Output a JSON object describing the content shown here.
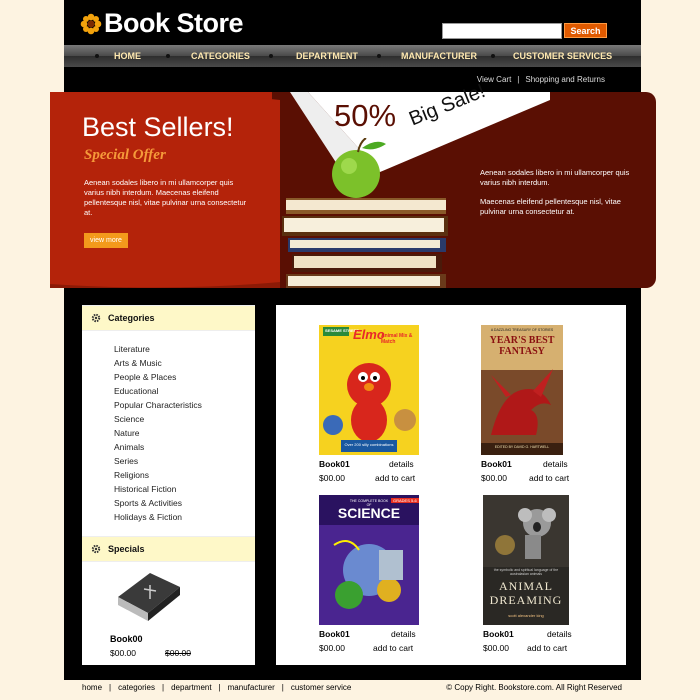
{
  "header": {
    "title": "Book Store",
    "search_placeholder": "",
    "search_button": "Search"
  },
  "nav": {
    "items": [
      "HOME",
      "CATEGORIES",
      "DEPARTMENT",
      "MANUFACTURER",
      "CUSTOMER SERVICES"
    ]
  },
  "sublinks": [
    "View Cart",
    "Shopping and Returns"
  ],
  "banner": {
    "title": "Best Sellers!",
    "subtitle": "Special Offer",
    "text": "Aenean sodales libero in mi ullamcorper quis varius nibh interdum. Maecenas eleifend pellentesque nisl, vitae pulvinar urna consectetur at.",
    "button": "view more",
    "sale_percent": "50%",
    "sale_text": "Big Sale!",
    "right_text_1": "Aenean sodales libero in mi ullamcorper quis varius nibh interdum.",
    "right_text_2": "Maecenas eleifend pellentesque nisl, vitae pulvinar urna consectetur at."
  },
  "sidebar": {
    "categories_title": "Categories",
    "categories": [
      "Literature",
      "Arts & Music",
      "People & Places",
      "Educational",
      "Popular Characteristics",
      "Science",
      "Nature",
      "Animals",
      "Series",
      "Religions",
      "Historical Fiction",
      "Sports & Activities",
      "Holidays & Fiction"
    ],
    "specials_title": "Specials",
    "special": {
      "name": "Book00",
      "price": "$00.00",
      "old_price": "$00.00",
      "cover_text": "Holy Bible"
    }
  },
  "products": [
    {
      "name": "Book01",
      "details": "details",
      "price": "$00.00",
      "cart": "add to cart",
      "cover_title": "Elmo",
      "cover_sub": "Animal Mix & Match",
      "cover_note": "Over 200 silly combinations",
      "cover_brand": "SESAME STREET"
    },
    {
      "name": "Book01",
      "details": "details",
      "price": "$00.00",
      "cart": "add to cart",
      "cover_title": "YEAR'S BEST FANTASY",
      "cover_sub": "A DAZZLING TREASURY OF STORIES",
      "cover_note": "EDITED BY DAVID G. HARTWELL"
    },
    {
      "name": "Book01",
      "details": "details",
      "price": "$00.00",
      "cart": "add to cart",
      "cover_title": "SCIENCE",
      "cover_sub": "THE COMPLETE BOOK OF",
      "cover_note": "GRADES 5-6"
    },
    {
      "name": "Book01",
      "details": "details",
      "price": "$00.00",
      "cart": "add to cart",
      "cover_title": "ANIMAL DREAMING",
      "cover_sub": "the symbolic and spiritual language of the australasian animals",
      "cover_note": "scott alexander king"
    }
  ],
  "footer": {
    "links": [
      "home",
      "categories",
      "department",
      "manufacturer",
      "customer service"
    ],
    "copyright": "© Copy Right. Bookstore.com. All Right Reserved"
  },
  "colors": {
    "page_bg": "#fdf3e1",
    "frame": "#000000",
    "accent_orange": "#e05a00",
    "banner_red": "#b4230a",
    "banner_dark": "#5a0f03",
    "header_yellow": "#fef8c8"
  },
  "icons": [
    "flower-logo-icon",
    "gear-icon",
    "apple-icon",
    "book-stack-icon",
    "bible-icon"
  ]
}
